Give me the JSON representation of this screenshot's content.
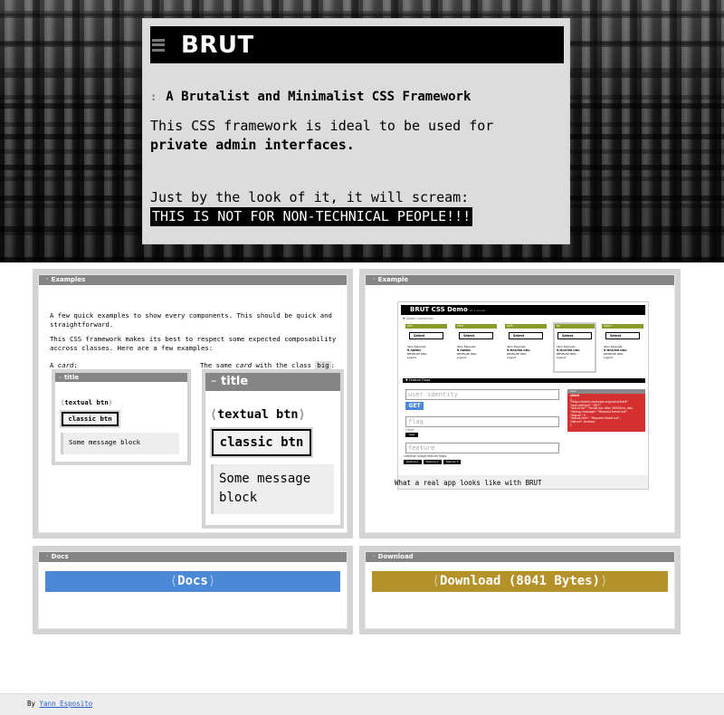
{
  "hero": {
    "title": "BRUT",
    "subtitle_prefix": ":",
    "subtitle": "A Brutalist and Minimalist CSS Framework",
    "p1_text": "This CSS framework is ideal to be used for ",
    "p1_bold": "private admin interfaces.",
    "p2_text": "Just by the look of it, it will scream:",
    "scream": "THIS IS NOT FOR NON-TECHNICAL PEOPLE!!!"
  },
  "examples": {
    "title": "Examples",
    "p1": "A few quick examples to show every components. This should be quick and straightforward.",
    "p2": "This CSS framework makes its best to respect some expected composability accross classes. Here are a few examples:",
    "card_label_a": "A ",
    "card_label_b": "card",
    "card_label_c": ":",
    "big_label_a": "The same ",
    "big_label_b": "card",
    "big_label_c": " with the class ",
    "big_label_d": "big",
    "big_label_e": ":",
    "card_title": "title",
    "textual_btn": "textual btn",
    "lang_open": "⟨",
    "lang_close": "⟩",
    "classic_btn": "classic btn",
    "message": "Some message block"
  },
  "example": {
    "title": "Example",
    "caption": "What a real app looks like with BRUT",
    "demo_title": "BRUT CSS Demo",
    "demo_version": "v0.1 emails",
    "global_connection": "▼ Global Connection",
    "environments": [
      {
        "name": "DEV",
        "select": "Select",
        "lines": [
          "Yann Esposito",
          "▼ ADMIN",
          "DEVELOP ORG",
          "Logout"
        ]
      },
      {
        "name": "TEST",
        "select": "Select",
        "lines": [
          "Yann Esposito",
          "▼ ADMIN",
          "DEVELOP ORG",
          "Logout"
        ]
      },
      {
        "name": "INTP",
        "select": "Select",
        "lines": [
          "Yann Esposito",
          "▼ MASTER ORG",
          "DEVELOP ORG",
          "Logout"
        ]
      },
      {
        "name": "PR",
        "select": "Select",
        "lines": [
          "Yann Esposito",
          "▼ MASTER ORG",
          "DEVELOP ORG",
          "Logout"
        ]
      },
      {
        "name": "PROD",
        "select": "Select",
        "lines": [
          "Yann Esposito",
          "▼ MASTER ORG",
          "DEVELOP ORG",
          "Logout"
        ]
      }
    ],
    "feature_flags": "▼ Feature Flags",
    "user_identity": "user identity",
    "get": "GET",
    "flag": "flag",
    "flag_note": "Other",
    "flag_btn": "beta",
    "feature": "feature",
    "feature_note": "common scope feature flags:",
    "feature_btns": [
      "feature-1",
      "feature-2",
      "feature-3"
    ],
    "user_head": "User",
    "user_label": "client",
    "user_lines": [
      "{",
      "  \"https://admin.example.org/users/###\"",
      "  \"last-method\": \"GET\"",
      "  \"last-error\": \"timed out after 30000ms, abo",
      "  \"debug-message\": \"Request timed out\",",
      "  \"status\": 0",
      "  \"status-text\": \"Request timed out\",",
      "  \"failure\": timeout",
      "}"
    ]
  },
  "docs": {
    "title": "Docs",
    "button": "Docs",
    "color": "#4b88d6"
  },
  "download": {
    "title": "Download",
    "button": "Download (8041 Bytes)",
    "color": "#b5912a"
  },
  "footer": {
    "by": "By ",
    "author": "Yann Esposito"
  },
  "icons": {
    "menu": "hamburger-icon",
    "panel_marker": "·"
  }
}
